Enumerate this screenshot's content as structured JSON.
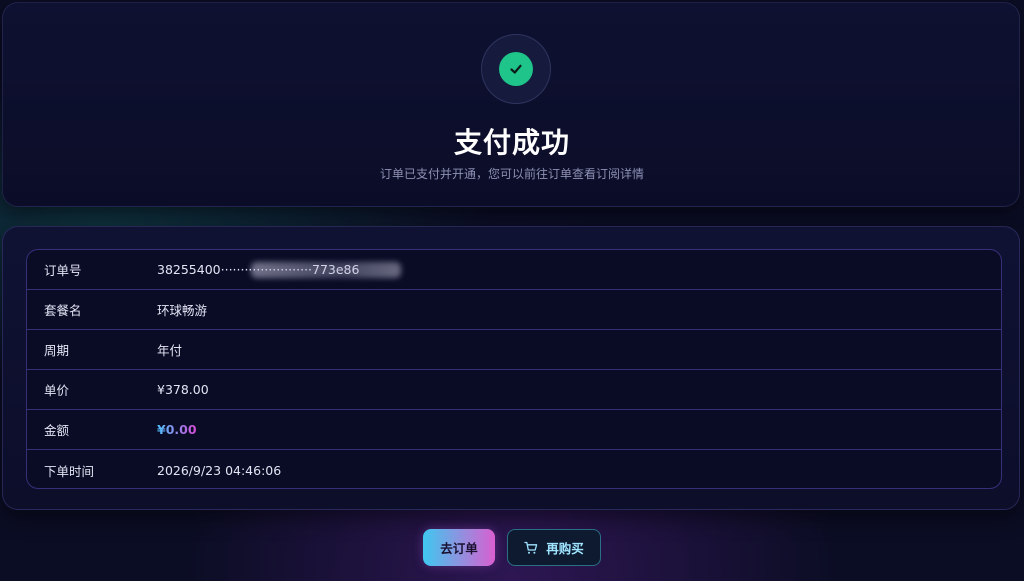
{
  "hero": {
    "title": "支付成功",
    "subtitle": "订单已支付并开通，您可以前往订单查看订阅详情",
    "icon": "check-circle-icon"
  },
  "details": {
    "rows": [
      {
        "label": "订单号",
        "value": "38255400·······················773e86"
      },
      {
        "label": "套餐名",
        "value": "环球畅游"
      },
      {
        "label": "周期",
        "value": "年付"
      },
      {
        "label": "单价",
        "value": "¥378.00"
      },
      {
        "label": "金额",
        "value": "¥0.00"
      },
      {
        "label": "下单时间",
        "value": "2026/9/23 04:46:06"
      }
    ]
  },
  "actions": {
    "orders_label": "去订单",
    "rebuy_label": "再购买",
    "rebuy_icon": "cart-icon"
  },
  "colors": {
    "success": "#1fc48a",
    "amount_gradient_start": "#4dc2ff",
    "amount_gradient_end": "#d84ad8"
  }
}
